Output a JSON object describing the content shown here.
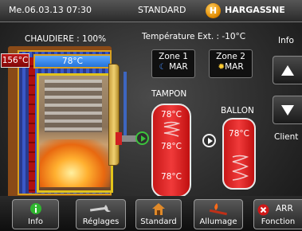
{
  "topbar": {
    "datetime": "Me.06.03.13 07:30",
    "mode": "STANDARD",
    "brand": "HARGASSNE"
  },
  "boiler": {
    "title": "CHAUDIERE : 100%",
    "flue_temp": "156°C",
    "water_temp": "78°C"
  },
  "outdoor": {
    "label": "Température Ext. : -10°C"
  },
  "zones": [
    {
      "name": "Zone 1",
      "status": "MAR",
      "icon": "moon-icon"
    },
    {
      "name": "Zone 2",
      "status": "MAR",
      "icon": "sun-icon"
    }
  ],
  "tampon": {
    "label": "TAMPON",
    "temp_top": "78°C",
    "temp_middle": "78°C",
    "temp_bottom": "78°C"
  },
  "ballon": {
    "label": "BALLON",
    "temp": "78°C"
  },
  "side": {
    "info_label": "Info",
    "client_label": "Client"
  },
  "bottom": {
    "info": "Info",
    "reglages": "Réglages",
    "standard": "Standard",
    "allumage": "Allumage",
    "arret_status": "ARR",
    "arret": "Fonction"
  },
  "colors": {
    "accent_green": "#3cc23c",
    "tank_red": "#e02020",
    "water_blue": "#2f7fe6",
    "frame_gold": "#d8a020"
  }
}
